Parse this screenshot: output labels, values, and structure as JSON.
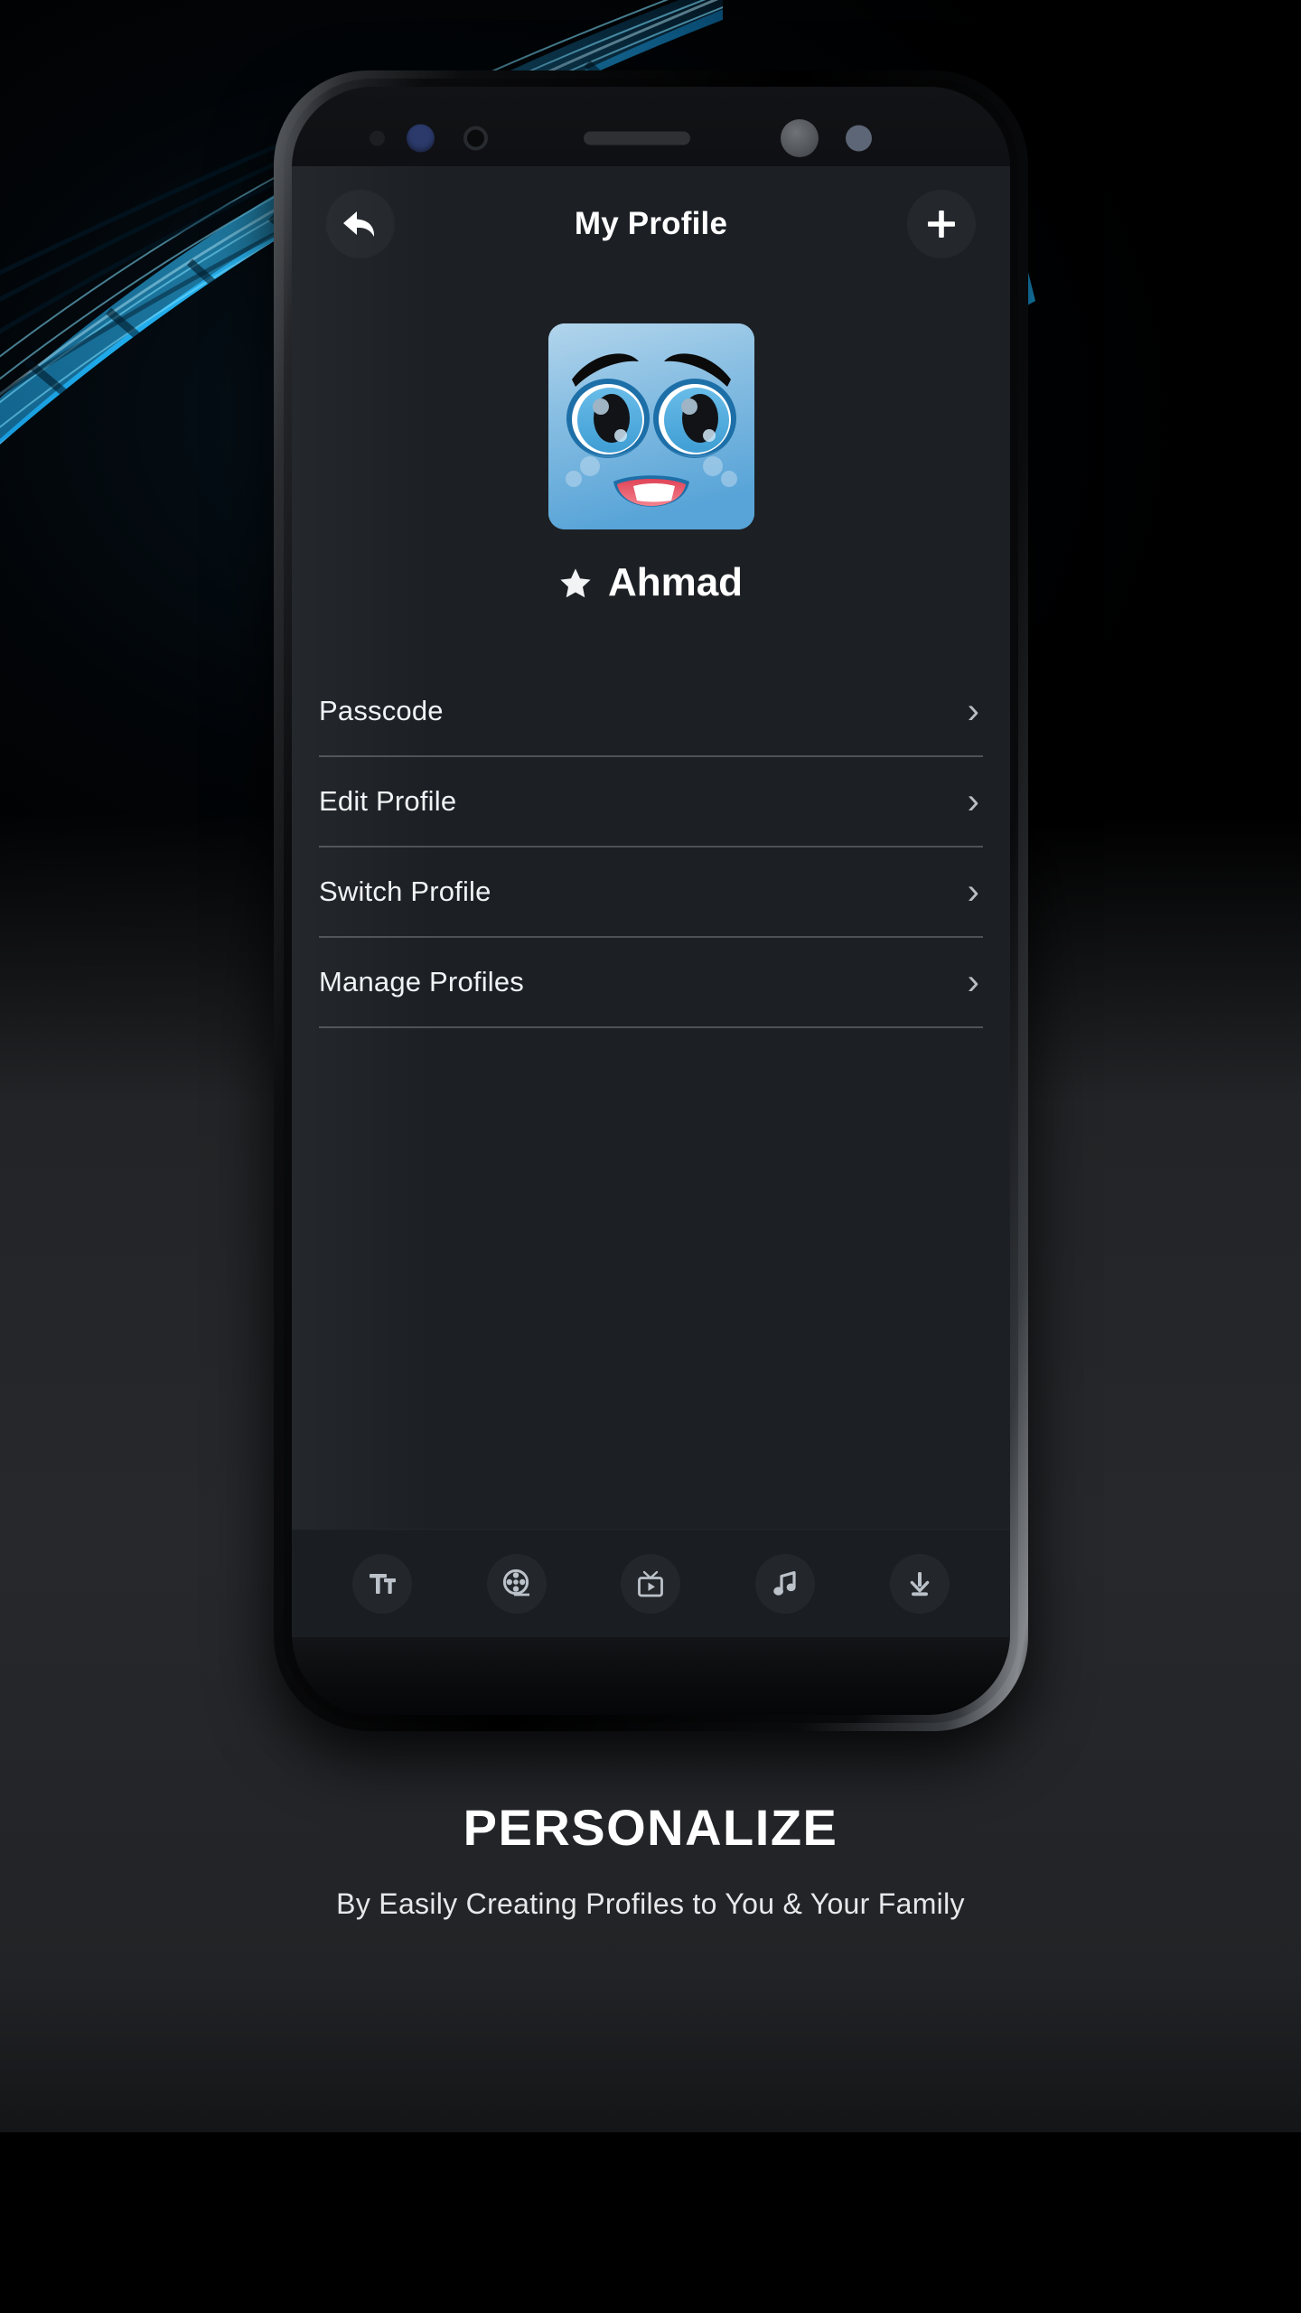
{
  "background": {
    "accent_blue": "#1ea7e8",
    "page_bg": "#000000",
    "lower_panel_bg": "#26282c"
  },
  "phone": {
    "screen_bg": "#1c2025",
    "bezel_color": "#0f1013",
    "sensors": [
      "proximity-dot",
      "iris-sensor",
      "ir-sensor",
      "earpiece-speaker",
      "front-camera",
      "light-sensor"
    ]
  },
  "header": {
    "title": "My Profile",
    "back_button": {
      "icon": "back-arrow-icon",
      "label": "Back"
    },
    "add_button": {
      "icon": "plus-icon",
      "label": "Add Profile"
    }
  },
  "profile": {
    "avatar_alt": "Blue smiling cartoon face avatar",
    "avatar_colors": {
      "face_top": "#a9cfe8",
      "face_bottom": "#5ba5d8",
      "eye_iris": "#4fa9dd",
      "eye_outline": "#1d6fa8",
      "mouth": "#e8495c",
      "mouth_dark": "#c9243c",
      "brow": "#0d0d0d"
    },
    "badge_icon": "star-icon",
    "name": "Ahmad"
  },
  "menu": {
    "items": [
      {
        "label": "Passcode",
        "icon": "chevron-right-icon"
      },
      {
        "label": "Edit Profile",
        "icon": "chevron-right-icon"
      },
      {
        "label": "Switch Profile",
        "icon": "chevron-right-icon"
      },
      {
        "label": "Manage Profiles",
        "icon": "chevron-right-icon"
      }
    ],
    "chevron": "›"
  },
  "bottom_nav": {
    "items": [
      {
        "name": "text-subtitles-icon",
        "label": "Text"
      },
      {
        "name": "film-reel-icon",
        "label": "Movies"
      },
      {
        "name": "tv-icon",
        "label": "TV"
      },
      {
        "name": "music-note-icon",
        "label": "Music"
      },
      {
        "name": "download-icon",
        "label": "Downloads"
      }
    ]
  },
  "caption": {
    "heading": "PERSONALIZE",
    "subheading": "By Easily Creating Profiles to You & Your Family"
  }
}
